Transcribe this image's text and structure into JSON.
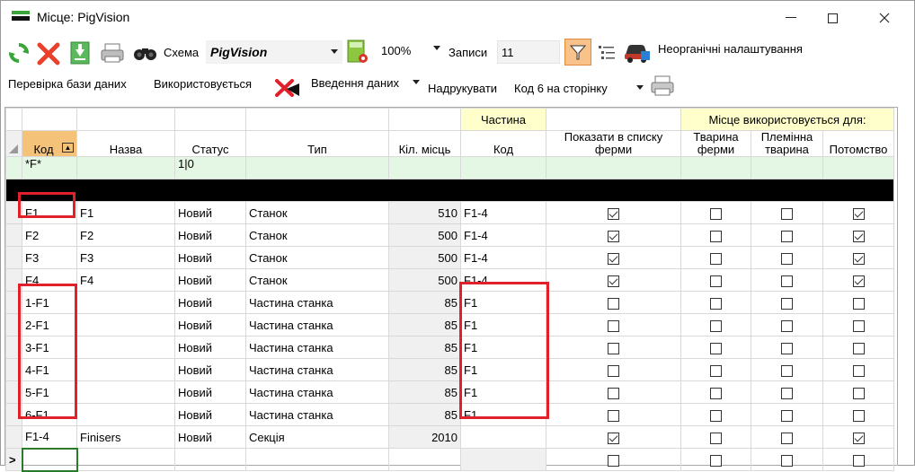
{
  "window": {
    "title": "Місце: PigVision"
  },
  "toolbar": {
    "schema_label": "Схема",
    "schema_value": "PigVision",
    "zoom_value": "100%",
    "records_label": "Записи",
    "records_value": "11",
    "unlimited_settings": "Неорганічні налаштування"
  },
  "toolbar2": {
    "check_db": "Перевірка бази даних",
    "in_use": "Використовується",
    "data_entry": "Введення даних",
    "print_label": "Надрукувати",
    "print_option": "Код 6 на сторінку"
  },
  "grid": {
    "group_part": "Частина",
    "group_use": "Місце використовується для:",
    "columns": {
      "code": "Код",
      "name": "Назва",
      "status": "Статус",
      "type": "Тип",
      "places": "Кіл. місць",
      "part_code": "Код",
      "show_in_list": "Показати в списку ферми",
      "farm_animal": "Тварина ферми",
      "breeding_animal": "Племінна тварина",
      "offspring": "Потомство"
    },
    "filter": {
      "code": "*F*",
      "status": "1|0"
    },
    "rows": [
      {
        "code": "F1",
        "name": "F1",
        "status": "Новий",
        "type": "Станок",
        "places": "510",
        "part": "F1-4"
      },
      {
        "code": "F2",
        "name": "F2",
        "status": "Новий",
        "type": "Станок",
        "places": "500",
        "part": "F1-4"
      },
      {
        "code": "F3",
        "name": "F3",
        "status": "Новий",
        "type": "Станок",
        "places": "500",
        "part": "F1-4"
      },
      {
        "code": "F4",
        "name": "F4",
        "status": "Новий",
        "type": "Станок",
        "places": "500",
        "part": "F1-4"
      },
      {
        "code": "1-F1",
        "name": "",
        "status": "Новий",
        "type": "Частина станка",
        "places": "85",
        "part": "F1"
      },
      {
        "code": "2-F1",
        "name": "",
        "status": "Новий",
        "type": "Частина станка",
        "places": "85",
        "part": "F1"
      },
      {
        "code": "3-F1",
        "name": "",
        "status": "Новий",
        "type": "Частина станка",
        "places": "85",
        "part": "F1"
      },
      {
        "code": "4-F1",
        "name": "",
        "status": "Новий",
        "type": "Частина станка",
        "places": "85",
        "part": "F1"
      },
      {
        "code": "5-F1",
        "name": "",
        "status": "Новий",
        "type": "Частина станка",
        "places": "85",
        "part": "F1"
      },
      {
        "code": "6-F1",
        "name": "",
        "status": "Новий",
        "type": "Частина станка",
        "places": "85",
        "part": "F1"
      },
      {
        "code": "F1-4",
        "name": "Finisers",
        "status": "Новий",
        "type": "Секція",
        "places": "2010",
        "part": ""
      }
    ],
    "new_row_marker": ">"
  }
}
